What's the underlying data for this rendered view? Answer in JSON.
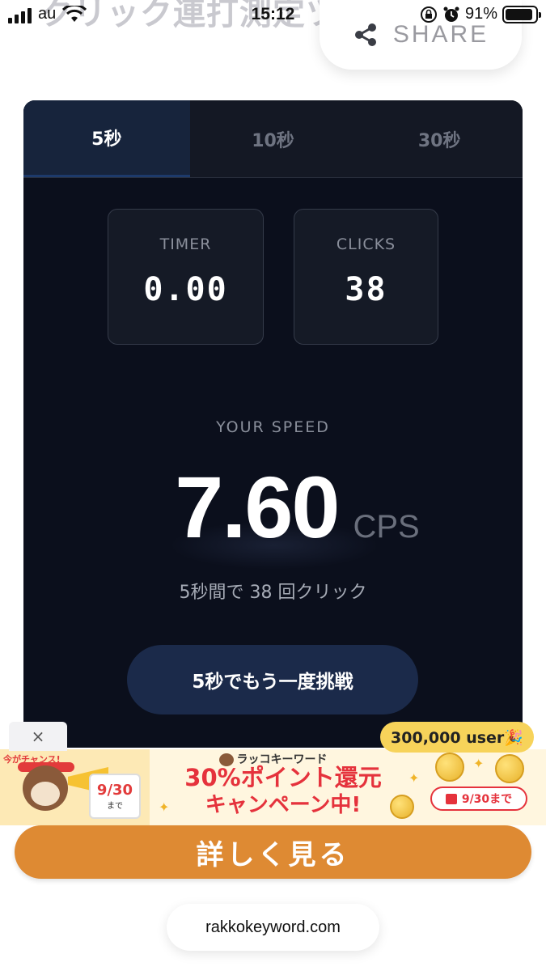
{
  "status_bar": {
    "carrier": "au",
    "time": "15:12",
    "battery_percent": "91%",
    "battery_level": 0.91,
    "icons": [
      "signal-icon",
      "wifi-icon",
      "orientation-lock-icon",
      "alarm-icon",
      "battery-icon"
    ]
  },
  "page": {
    "title_partial": "クリック連打測定ツール"
  },
  "share": {
    "label": "SHARE",
    "icon": "share-icon"
  },
  "tabs": [
    {
      "label": "5秒",
      "active": true
    },
    {
      "label": "10秒",
      "active": false
    },
    {
      "label": "30秒",
      "active": false
    }
  ],
  "stats": {
    "timer_label": "TIMER",
    "timer_value": "0.00",
    "clicks_label": "CLICKS",
    "clicks_value": "38"
  },
  "speed": {
    "label": "YOUR SPEED",
    "value": "7.60",
    "unit": "CPS",
    "summary": "5秒間で 38 回クリック"
  },
  "retry_button": "5秒でもう一度挑戦",
  "ad": {
    "close_label": "×",
    "user_badge": "300,000 user🎉",
    "brand": "ラッコキーワード",
    "chance_text": "今がチャンス!",
    "calendar_date": "9/30",
    "calendar_suffix": "まで",
    "headline_line1": "30%ポイント還元",
    "headline_line2": "キャンペーン中!",
    "date_pill": "9/30まで",
    "cta": "詳しく見る",
    "colors": {
      "cta": "#de8a33",
      "headline": "#e5323c",
      "badge": "#f7d35a"
    }
  },
  "footer": {
    "url": "rakkokeyword.com"
  },
  "colors": {
    "card_bg": "#0b0f1c",
    "tab_active_bg": "#17243c",
    "retry_bg": "#1b2a4a"
  }
}
